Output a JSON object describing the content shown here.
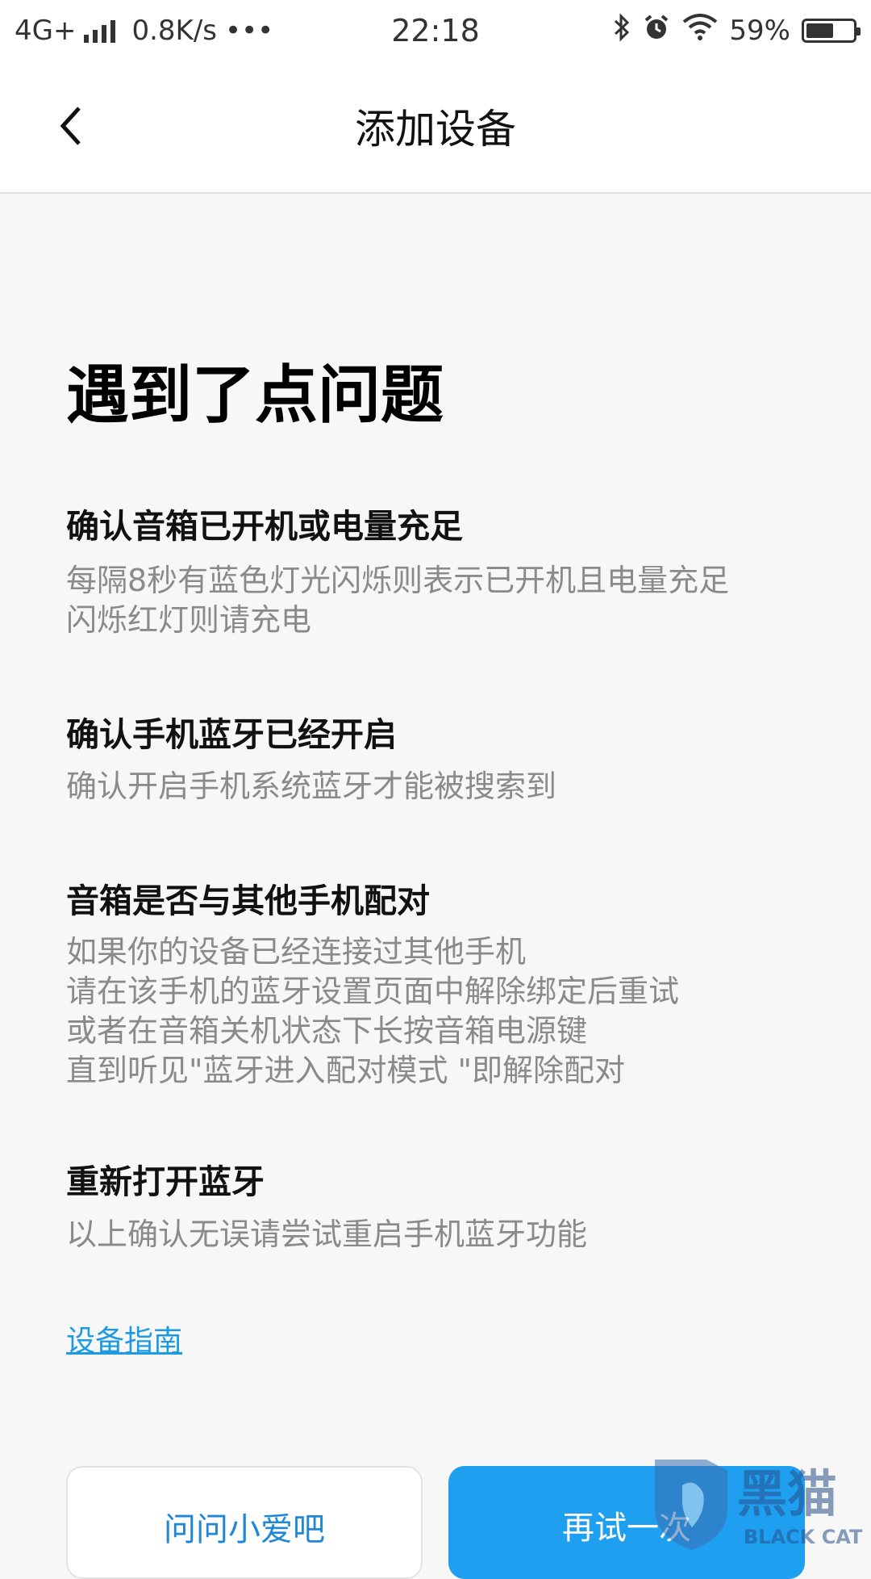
{
  "status_bar": {
    "network": "4G+",
    "speed": "0.8K/s",
    "more": "•••",
    "time": "22:18",
    "battery_text": "59%",
    "battery_level": 0.59
  },
  "header": {
    "title": "添加设备"
  },
  "main": {
    "title": "遇到了点问题",
    "sections": [
      {
        "title": "确认音箱已开机或电量充足",
        "lines": [
          "每隔8秒有蓝色灯光闪烁则表示已开机且电量充足",
          "闪烁红灯则请充电"
        ]
      },
      {
        "title": "确认手机蓝牙已经开启",
        "lines": [
          "确认开启手机系统蓝牙才能被搜索到"
        ]
      },
      {
        "title": "音箱是否与其他手机配对",
        "lines": [
          "如果你的设备已经连接过其他手机",
          "请在该手机的蓝牙设置页面中解除绑定后重试",
          "或者在音箱关机状态下长按音箱电源键",
          "直到听见\"蓝牙进入配对模式 \"即解除配对"
        ]
      },
      {
        "title": "重新打开蓝牙",
        "lines": [
          "以上确认无误请尝试重启手机蓝牙功能"
        ]
      }
    ],
    "guide_link": "设备指南"
  },
  "buttons": {
    "ask": "问问小爱吧",
    "retry": "再试一次"
  },
  "watermark": {
    "text_cn": "黑猫",
    "text_en": "BLACK CAT"
  },
  "colors": {
    "accent": "#1e9fef",
    "link": "#1e9be0",
    "desc": "#8a8a8a"
  }
}
